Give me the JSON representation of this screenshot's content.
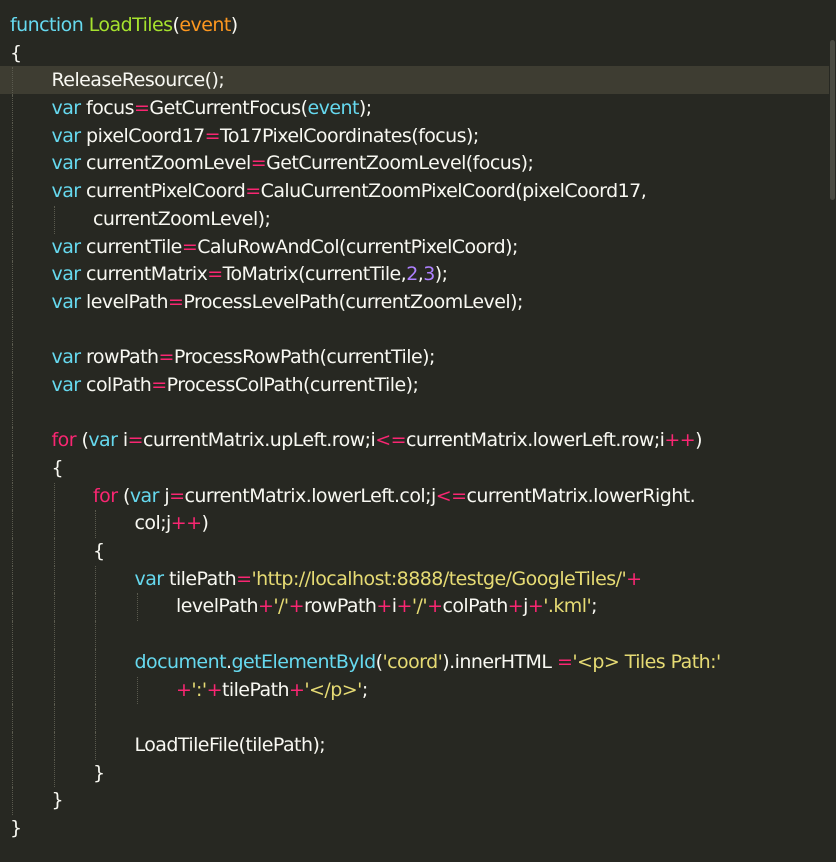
{
  "editor": {
    "theme_colors": {
      "background": "#272822",
      "current_line": "#3e3d32",
      "text": "#f8f8f2",
      "keyword": "#f92672",
      "storage": "#66d9ef",
      "function": "#a6e22e",
      "parameter": "#fd971f",
      "number": "#ae81ff",
      "string": "#e6db74"
    },
    "current_line_index": 2,
    "lines": [
      {
        "indent": 0,
        "tokens": [
          [
            "st",
            "function"
          ],
          [
            "tx",
            " "
          ],
          [
            "fn",
            "LoadTiles"
          ],
          [
            "tx",
            "("
          ],
          [
            "pa",
            "event"
          ],
          [
            "tx",
            ")"
          ]
        ]
      },
      {
        "indent": 0,
        "tokens": [
          [
            "tx",
            "{"
          ]
        ]
      },
      {
        "indent": 1,
        "tokens": [
          [
            "tx",
            "ReleaseResource();"
          ]
        ]
      },
      {
        "indent": 1,
        "tokens": [
          [
            "st",
            "var"
          ],
          [
            "tx",
            " focus"
          ],
          [
            "op",
            "="
          ],
          [
            "tx",
            "GetCurrentFocus("
          ],
          [
            "vb",
            "event"
          ],
          [
            "tx",
            ");"
          ]
        ]
      },
      {
        "indent": 1,
        "tokens": [
          [
            "st",
            "var"
          ],
          [
            "tx",
            " pixelCoord17"
          ],
          [
            "op",
            "="
          ],
          [
            "tx",
            "To17PixelCoordinates(focus);"
          ]
        ]
      },
      {
        "indent": 1,
        "tokens": [
          [
            "st",
            "var"
          ],
          [
            "tx",
            " currentZoomLevel"
          ],
          [
            "op",
            "="
          ],
          [
            "tx",
            "GetCurrentZoomLevel(focus);"
          ]
        ]
      },
      {
        "indent": 1,
        "tokens": [
          [
            "st",
            "var"
          ],
          [
            "tx",
            " currentPixelCoord"
          ],
          [
            "op",
            "="
          ],
          [
            "tx",
            "CaluCurrentZoomPixelCoord(pixelCoord17,"
          ]
        ]
      },
      {
        "indent": 2,
        "tokens": [
          [
            "tx",
            "currentZoomLevel);"
          ]
        ]
      },
      {
        "indent": 1,
        "tokens": [
          [
            "st",
            "var"
          ],
          [
            "tx",
            " currentTile"
          ],
          [
            "op",
            "="
          ],
          [
            "tx",
            "CaluRowAndCol(currentPixelCoord);"
          ]
        ]
      },
      {
        "indent": 1,
        "tokens": [
          [
            "st",
            "var"
          ],
          [
            "tx",
            " currentMatrix"
          ],
          [
            "op",
            "="
          ],
          [
            "tx",
            "ToMatrix(currentTile,"
          ],
          [
            "nm",
            "2"
          ],
          [
            "tx",
            ","
          ],
          [
            "nm",
            "3"
          ],
          [
            "tx",
            ");"
          ]
        ]
      },
      {
        "indent": 1,
        "tokens": [
          [
            "st",
            "var"
          ],
          [
            "tx",
            " levelPath"
          ],
          [
            "op",
            "="
          ],
          [
            "tx",
            "ProcessLevelPath(currentZoomLevel);"
          ]
        ]
      },
      {
        "indent": 1,
        "tokens": []
      },
      {
        "indent": 1,
        "tokens": [
          [
            "st",
            "var"
          ],
          [
            "tx",
            " rowPath"
          ],
          [
            "op",
            "="
          ],
          [
            "tx",
            "ProcessRowPath(currentTile);"
          ]
        ]
      },
      {
        "indent": 1,
        "tokens": [
          [
            "st",
            "var"
          ],
          [
            "tx",
            " colPath"
          ],
          [
            "op",
            "="
          ],
          [
            "tx",
            "ProcessColPath(currentTile);"
          ]
        ]
      },
      {
        "indent": 1,
        "tokens": []
      },
      {
        "indent": 1,
        "tokens": [
          [
            "kw",
            "for"
          ],
          [
            "tx",
            " ("
          ],
          [
            "st",
            "var"
          ],
          [
            "tx",
            " i"
          ],
          [
            "op",
            "="
          ],
          [
            "tx",
            "currentMatrix.upLeft.row;i"
          ],
          [
            "op",
            "<="
          ],
          [
            "tx",
            "currentMatrix.lowerLeft.row;i"
          ],
          [
            "op",
            "++"
          ],
          [
            "tx",
            ")"
          ]
        ]
      },
      {
        "indent": 1,
        "tokens": [
          [
            "tx",
            "{"
          ]
        ]
      },
      {
        "indent": 2,
        "tokens": [
          [
            "kw",
            "for"
          ],
          [
            "tx",
            " ("
          ],
          [
            "st",
            "var"
          ],
          [
            "tx",
            " j"
          ],
          [
            "op",
            "="
          ],
          [
            "tx",
            "currentMatrix.lowerLeft.col;j"
          ],
          [
            "op",
            "<="
          ],
          [
            "tx",
            "currentMatrix.lowerRight."
          ]
        ]
      },
      {
        "indent": 3,
        "tokens": [
          [
            "tx",
            "col;j"
          ],
          [
            "op",
            "++"
          ],
          [
            "tx",
            ")"
          ]
        ]
      },
      {
        "indent": 2,
        "tokens": [
          [
            "tx",
            "{"
          ]
        ]
      },
      {
        "indent": 3,
        "tokens": [
          [
            "st",
            "var"
          ],
          [
            "tx",
            " tilePath"
          ],
          [
            "op",
            "="
          ],
          [
            "sr",
            "'http://localhost:8888/testge/GoogleTiles/'"
          ],
          [
            "op",
            "+"
          ]
        ]
      },
      {
        "indent": 4,
        "tokens": [
          [
            "tx",
            "levelPath"
          ],
          [
            "op",
            "+"
          ],
          [
            "sr",
            "'/'"
          ],
          [
            "op",
            "+"
          ],
          [
            "tx",
            "rowPath"
          ],
          [
            "op",
            "+"
          ],
          [
            "tx",
            "i"
          ],
          [
            "op",
            "+"
          ],
          [
            "sr",
            "'/'"
          ],
          [
            "op",
            "+"
          ],
          [
            "tx",
            "colPath"
          ],
          [
            "op",
            "+"
          ],
          [
            "tx",
            "j"
          ],
          [
            "op",
            "+"
          ],
          [
            "sr",
            "'.kml'"
          ],
          [
            "tx",
            ";"
          ]
        ]
      },
      {
        "indent": 3,
        "tokens": []
      },
      {
        "indent": 3,
        "tokens": [
          [
            "vb",
            "document"
          ],
          [
            "tx",
            "."
          ],
          [
            "vb",
            "getElementById"
          ],
          [
            "tx",
            "("
          ],
          [
            "sr",
            "'coord'"
          ],
          [
            "tx",
            ").innerHTML "
          ],
          [
            "op",
            "="
          ],
          [
            "sr",
            "'<p> Tiles Path:'"
          ]
        ]
      },
      {
        "indent": 4,
        "tokens": [
          [
            "op",
            "+"
          ],
          [
            "sr",
            "':'"
          ],
          [
            "op",
            "+"
          ],
          [
            "tx",
            "tilePath"
          ],
          [
            "op",
            "+"
          ],
          [
            "sr",
            "'</p>'"
          ],
          [
            "tx",
            ";"
          ]
        ]
      },
      {
        "indent": 3,
        "tokens": []
      },
      {
        "indent": 3,
        "tokens": [
          [
            "tx",
            "LoadTileFile(tilePath);"
          ]
        ]
      },
      {
        "indent": 2,
        "tokens": [
          [
            "tx",
            "}"
          ]
        ]
      },
      {
        "indent": 1,
        "tokens": [
          [
            "tx",
            "}"
          ]
        ]
      },
      {
        "indent": 0,
        "tokens": [
          [
            "tx",
            "}"
          ]
        ]
      }
    ]
  }
}
